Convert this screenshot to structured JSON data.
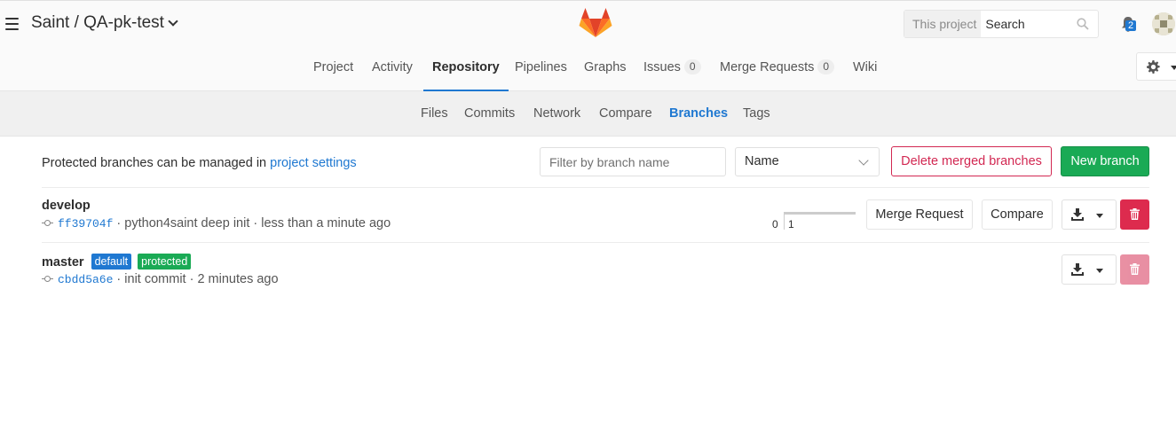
{
  "header": {
    "project_path": "Saint / QA-pk-test",
    "search_scope": "This project",
    "search_placeholder": "Search",
    "notifications_count": "2"
  },
  "main_nav": [
    {
      "label": "Project"
    },
    {
      "label": "Activity"
    },
    {
      "label": "Repository",
      "active": true
    },
    {
      "label": "Pipelines"
    },
    {
      "label": "Graphs"
    },
    {
      "label": "Issues",
      "count": "0"
    },
    {
      "label": "Merge Requests",
      "count": "0"
    },
    {
      "label": "Wiki"
    }
  ],
  "sub_nav": [
    {
      "label": "Files"
    },
    {
      "label": "Commits"
    },
    {
      "label": "Network"
    },
    {
      "label": "Compare"
    },
    {
      "label": "Branches",
      "active": true
    },
    {
      "label": "Tags"
    }
  ],
  "toolbar": {
    "info_prefix": "Protected branches can be managed in",
    "info_link": "project settings",
    "filter_placeholder": "Filter by branch name",
    "sort_value": "Name",
    "delete_merged_label": "Delete merged branches",
    "new_branch_label": "New branch"
  },
  "branches": [
    {
      "name": "develop",
      "sha": "ff39704f",
      "commit_message": "python4saint deep init",
      "time": "less than a minute ago",
      "behind": "0",
      "ahead": "1",
      "merge_request_label": "Merge Request",
      "compare_label": "Compare"
    },
    {
      "name": "master",
      "labels": [
        "default",
        "protected"
      ],
      "sha": "cbdd5a6e",
      "commit_message": "init commit",
      "time": "2 minutes ago"
    }
  ],
  "colors": {
    "accent": "#1f78d1",
    "success": "#1aaa55",
    "danger": "#dd2b4e"
  }
}
